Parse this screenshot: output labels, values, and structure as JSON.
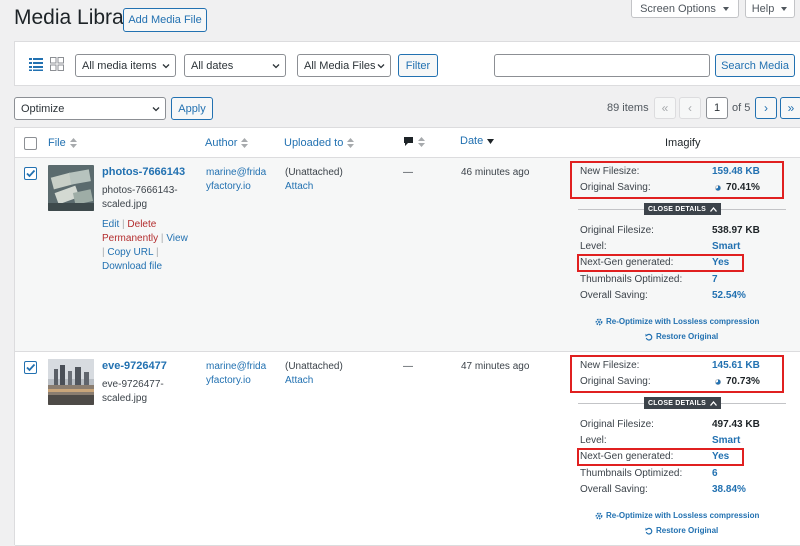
{
  "header": {
    "title": "Media Library",
    "add_media": "Add Media File",
    "screen_options": "Screen Options",
    "help": "Help"
  },
  "filters": {
    "media_items": "All media items",
    "dates": "All dates",
    "media_files": "All Media Files",
    "filter_button": "Filter",
    "search_placeholder": "",
    "search_button": "Search Media"
  },
  "bulk": {
    "action": "Optimize",
    "apply": "Apply"
  },
  "pagination": {
    "items": "89 items",
    "first": "«",
    "prev": "‹",
    "current": "1",
    "of": "of 5",
    "next": "›",
    "last": "»"
  },
  "columns": {
    "file": "File",
    "author": "Author",
    "uploaded_to": "Uploaded to",
    "date": "Date",
    "imagify": "Imagify"
  },
  "rows": [
    {
      "checked": true,
      "title": "photos-7666143",
      "filename_line1": "photos-7666143-",
      "filename_line2": "scaled.jpg",
      "action_edit": "Edit",
      "action_delete_1": "Delete",
      "action_delete_2": "Permanently",
      "action_view": "View",
      "action_copy": "Copy URL",
      "action_download": "Download file",
      "author_line1": "marine@frida",
      "author_line2": "yfactory.io",
      "uploaded": "(Unattached)",
      "attach": "Attach",
      "comments": "—",
      "date": "46 minutes ago",
      "imagify": {
        "new_filesize_label": "New Filesize:",
        "new_filesize": "159.48 KB",
        "original_saving_label": "Original Saving:",
        "original_saving": "70.41%",
        "close_details": "CLOSE DETAILS",
        "original_filesize_label": "Original Filesize:",
        "original_filesize": "538.97 KB",
        "level_label": "Level:",
        "level": "Smart",
        "nextgen_label": "Next-Gen generated:",
        "nextgen": "Yes",
        "thumbs_label": "Thumbnails Optimized:",
        "thumbs": "7",
        "overall_label": "Overall Saving:",
        "overall": "52.54%",
        "reoptimize": "Re-Optimize with Lossless compression",
        "restore": "Restore Original"
      }
    },
    {
      "checked": true,
      "title": "eve-9726477",
      "filename_line1": "eve-9726477-",
      "filename_line2": "scaled.jpg",
      "author_line1": "marine@frida",
      "author_line2": "yfactory.io",
      "uploaded": "(Unattached)",
      "attach": "Attach",
      "comments": "—",
      "date": "47 minutes ago",
      "imagify": {
        "new_filesize_label": "New Filesize:",
        "new_filesize": "145.61 KB",
        "original_saving_label": "Original Saving:",
        "original_saving": "70.73%",
        "close_details": "CLOSE DETAILS",
        "original_filesize_label": "Original Filesize:",
        "original_filesize": "497.43 KB",
        "level_label": "Level:",
        "level": "Smart",
        "nextgen_label": "Next-Gen generated:",
        "nextgen": "Yes",
        "thumbs_label": "Thumbnails Optimized:",
        "thumbs": "6",
        "overall_label": "Overall Saving:",
        "overall": "38.84%",
        "reoptimize": "Re-Optimize with Lossless compression",
        "restore": "Restore Original"
      }
    }
  ],
  "colors": {
    "link": "#2271b1",
    "delete": "#b32d2e",
    "highlight_box": "#e02020",
    "details_bar": "#3c434a"
  }
}
